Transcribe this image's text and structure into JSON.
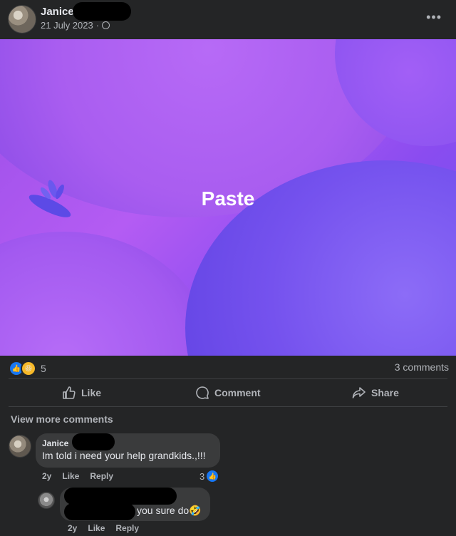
{
  "post": {
    "author": "Janice",
    "date": "21 July 2023",
    "separator": "·",
    "image_text": "Paste",
    "reaction_count": "5",
    "comments_count": "3 comments",
    "actions": {
      "like": "Like",
      "comment": "Comment",
      "share": "Share"
    },
    "icons": {
      "more": "more-options-icon",
      "privacy": "globe-icon",
      "like": "thumbs-up-icon",
      "comment": "comment-bubble-icon",
      "share": "share-arrow-icon"
    }
  },
  "comments": {
    "view_more": "View more comments",
    "items": [
      {
        "author": "Janice",
        "text": "Im told i need your help grandkids.,!!!",
        "time": "2y",
        "like": "Like",
        "reply": "Reply",
        "reaction_count": "3"
      },
      {
        "text": "you sure do",
        "emoji": "🤣",
        "time": "2y",
        "like": "Like",
        "reply": "Reply"
      }
    ]
  },
  "colors": {
    "background": "#242526",
    "bubble": "#3a3b3c",
    "text_primary": "#e4e6eb",
    "text_secondary": "#b0b3b8",
    "like_blue": "#1877f2",
    "haha_yellow": "#f7b928"
  }
}
